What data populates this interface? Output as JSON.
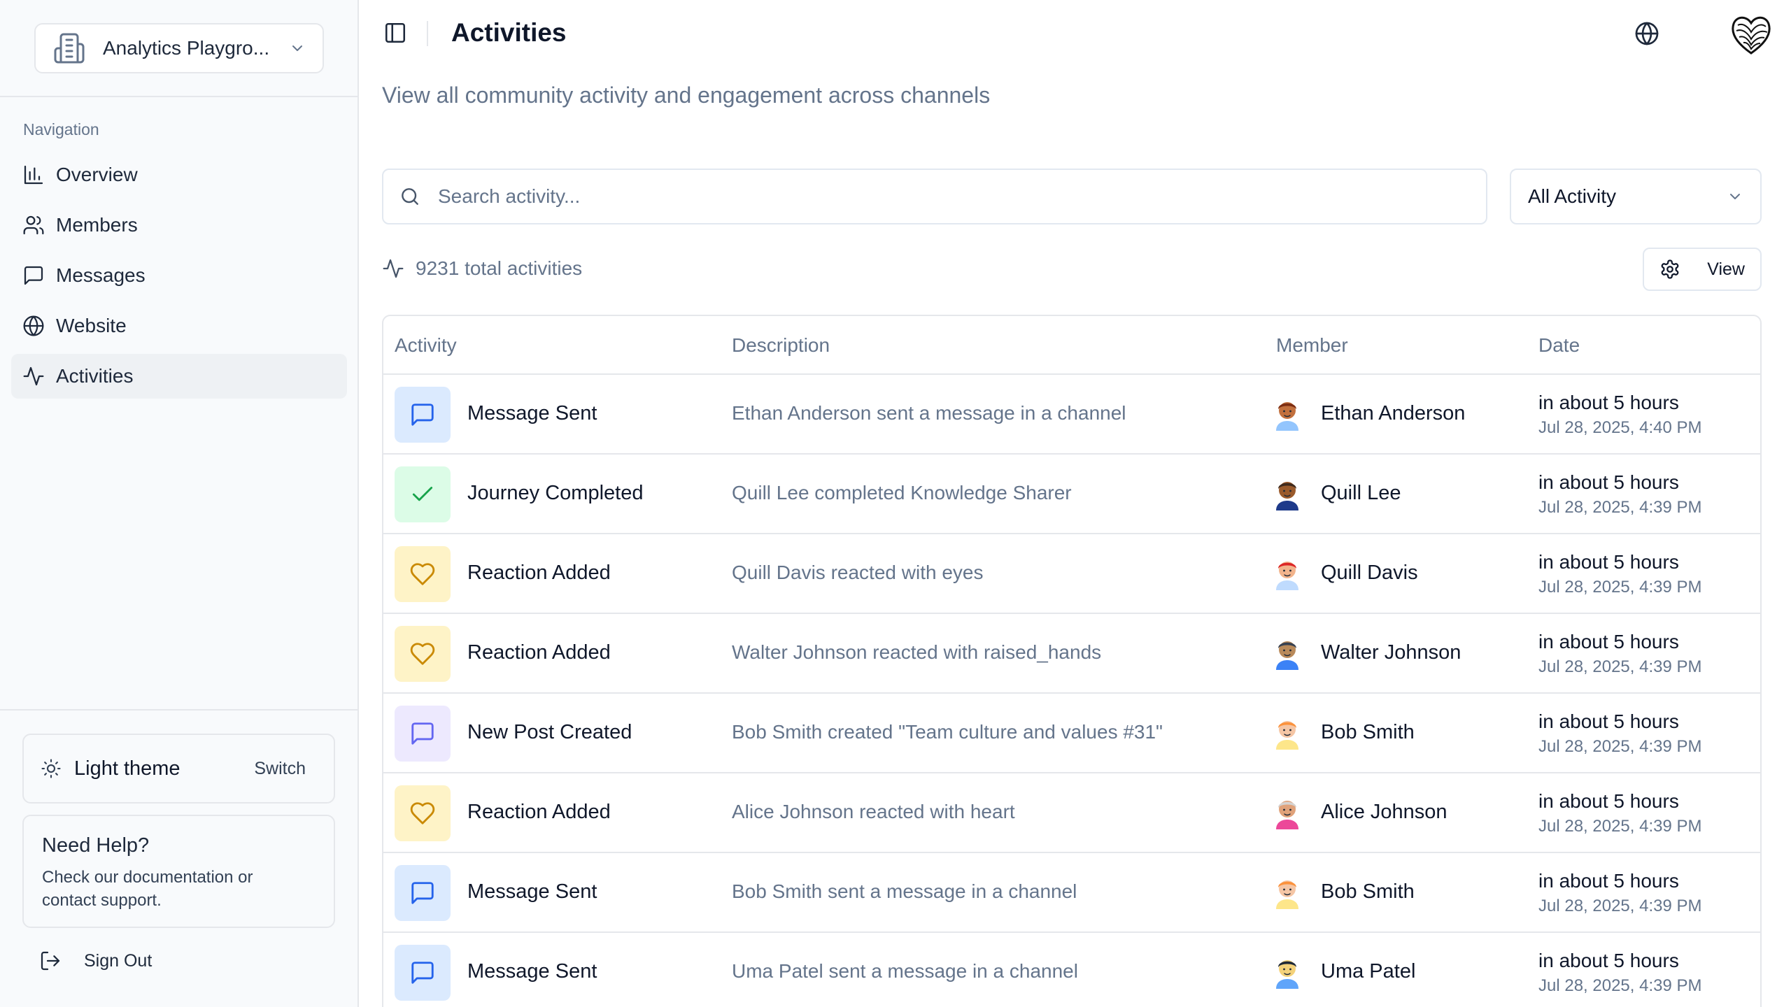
{
  "sidebar": {
    "org_name": "Analytics Playgro...",
    "nav_heading": "Navigation",
    "items": [
      {
        "label": "Overview",
        "icon": "bar-chart-icon"
      },
      {
        "label": "Members",
        "icon": "users-icon"
      },
      {
        "label": "Messages",
        "icon": "message-square-icon"
      },
      {
        "label": "Website",
        "icon": "globe-icon"
      },
      {
        "label": "Activities",
        "icon": "activity-icon",
        "active": true
      }
    ],
    "theme_label": "Light theme",
    "theme_switch": "Switch",
    "help_title": "Need Help?",
    "help_text": "Check our documentation or contact support.",
    "sign_out": "Sign Out"
  },
  "header": {
    "title": "Activities",
    "subtitle": "View all community activity and engagement across channels"
  },
  "toolbar": {
    "search_placeholder": "Search activity...",
    "filter_value": "All Activity",
    "count_text": "9231 total activities",
    "view_label": "View"
  },
  "table": {
    "columns": [
      "Activity",
      "Description",
      "Member",
      "Date"
    ],
    "rows": [
      {
        "kind": "msg",
        "type": "Message Sent",
        "description": "Ethan Anderson sent a message in a channel",
        "member": "Ethan Anderson",
        "relative": "in about 5 hours",
        "date": "Jul 28, 2025, 4:40 PM",
        "avatar": {
          "skin": "#c2703d",
          "hair": "#7c2d12",
          "shirt": "#93c5fd"
        }
      },
      {
        "kind": "done",
        "type": "Journey Completed",
        "description": "Quill Lee completed Knowledge Sharer",
        "member": "Quill Lee",
        "relative": "in about 5 hours",
        "date": "Jul 28, 2025, 4:39 PM",
        "avatar": {
          "skin": "#9a5a2b",
          "hair": "#3f2a1d",
          "shirt": "#1e3a8a"
        }
      },
      {
        "kind": "react",
        "type": "Reaction Added",
        "description": "Quill Davis reacted with eyes",
        "member": "Quill Davis",
        "relative": "in about 5 hours",
        "date": "Jul 28, 2025, 4:39 PM",
        "avatar": {
          "skin": "#f2b48c",
          "hair": "#dc2626",
          "shirt": "#bfdbfe"
        }
      },
      {
        "kind": "react",
        "type": "Reaction Added",
        "description": "Walter Johnson reacted with raised_hands",
        "member": "Walter Johnson",
        "relative": "in about 5 hours",
        "date": "Jul 28, 2025, 4:39 PM",
        "avatar": {
          "skin": "#b98a5a",
          "hair": "#374151",
          "shirt": "#3b82f6"
        }
      },
      {
        "kind": "post",
        "type": "New Post Created",
        "description": "Bob Smith created \"Team culture and values #31\"",
        "member": "Bob Smith",
        "relative": "in about 5 hours",
        "date": "Jul 28, 2025, 4:39 PM",
        "avatar": {
          "skin": "#f5c6a5",
          "hair": "#fb923c",
          "shirt": "#fde68a"
        }
      },
      {
        "kind": "react",
        "type": "Reaction Added",
        "description": "Alice Johnson reacted with heart",
        "member": "Alice Johnson",
        "relative": "in about 5 hours",
        "date": "Jul 28, 2025, 4:39 PM",
        "avatar": {
          "skin": "#e0a27a",
          "hair": "#d6d3d1",
          "shirt": "#ec4899"
        }
      },
      {
        "kind": "msg",
        "type": "Message Sent",
        "description": "Bob Smith sent a message in a channel",
        "member": "Bob Smith",
        "relative": "in about 5 hours",
        "date": "Jul 28, 2025, 4:39 PM",
        "avatar": {
          "skin": "#f5c6a5",
          "hair": "#fb923c",
          "shirt": "#fde68a"
        }
      },
      {
        "kind": "msg",
        "type": "Message Sent",
        "description": "Uma Patel sent a message in a channel",
        "member": "Uma Patel",
        "relative": "in about 5 hours",
        "date": "Jul 28, 2025, 4:39 PM",
        "avatar": {
          "skin": "#f4d27a",
          "hair": "#1f2937",
          "shirt": "#60a5fa"
        }
      }
    ]
  }
}
